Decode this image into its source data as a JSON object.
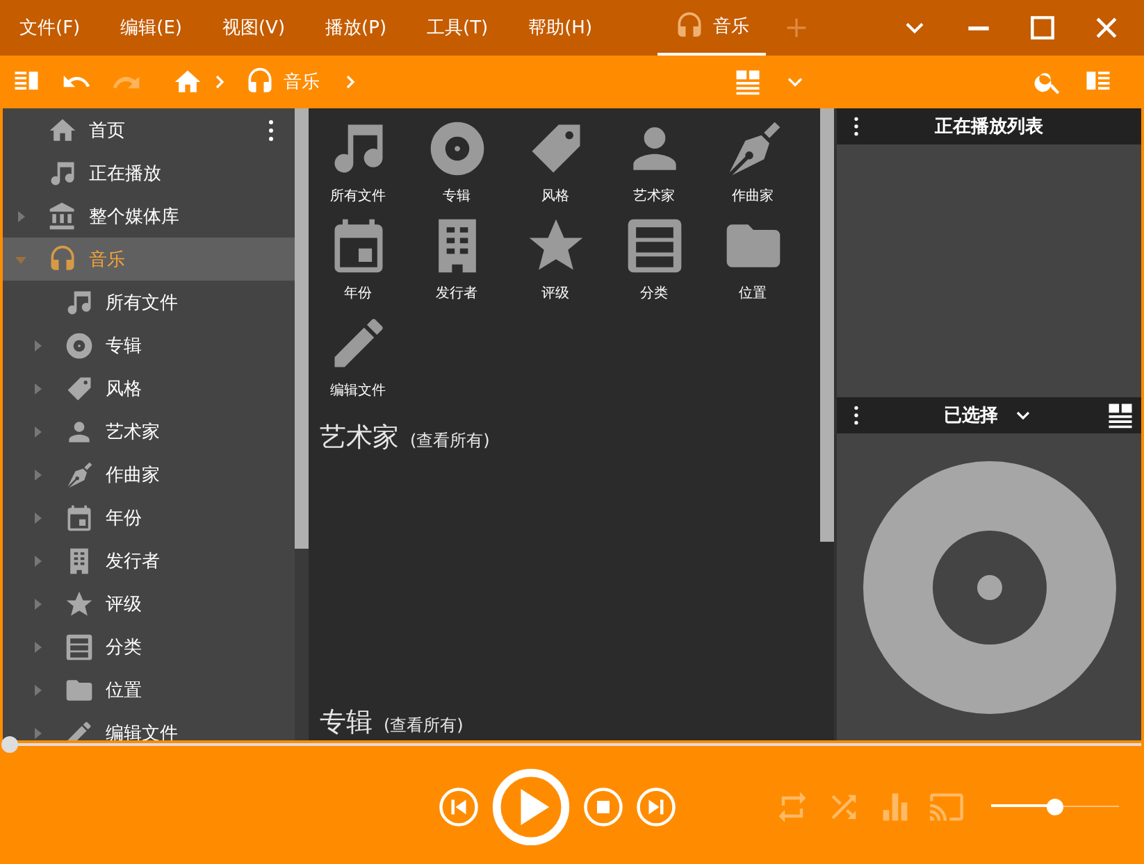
{
  "menu": [
    "文件(F)",
    "编辑(E)",
    "视图(V)",
    "播放(P)",
    "工具(T)",
    "帮助(H)"
  ],
  "tabs": [
    {
      "label": "音乐",
      "selected": true
    }
  ],
  "toolbar": {
    "redo": {
      "disabled": true
    },
    "breadcrumb": [
      "音乐"
    ]
  },
  "sidebar": {
    "items": [
      {
        "label": "首页",
        "kind": "leaf",
        "selected": false
      },
      {
        "label": "正在播放",
        "kind": "leaf",
        "selected": false
      },
      {
        "label": "整个媒体库",
        "kind": "folder",
        "expanded": false,
        "selected": false
      },
      {
        "label": "音乐",
        "kind": "folder",
        "expanded": true,
        "selected": true,
        "children": [
          {
            "label": "所有文件",
            "kind": "leaf",
            "selected": false
          },
          {
            "label": "专辑",
            "kind": "folder",
            "expanded": false,
            "selected": false
          },
          {
            "label": "风格",
            "kind": "folder",
            "expanded": false,
            "selected": false
          },
          {
            "label": "艺术家",
            "kind": "folder",
            "expanded": false,
            "selected": false
          },
          {
            "label": "作曲家",
            "kind": "folder",
            "expanded": false,
            "selected": false
          },
          {
            "label": "年份",
            "kind": "folder",
            "expanded": false,
            "selected": false
          },
          {
            "label": "发行者",
            "kind": "folder",
            "expanded": false,
            "selected": false
          },
          {
            "label": "评级",
            "kind": "folder",
            "expanded": false,
            "selected": false
          },
          {
            "label": "分类",
            "kind": "folder",
            "expanded": false,
            "selected": false
          },
          {
            "label": "位置",
            "kind": "folder",
            "expanded": false,
            "selected": false
          },
          {
            "label": "编辑文件",
            "kind": "folder",
            "expanded": false,
            "selected": false
          }
        ]
      }
    ]
  },
  "categories": [
    "所有文件",
    "专辑",
    "风格",
    "艺术家",
    "作曲家",
    "年份",
    "发行者",
    "评级",
    "分类",
    "位置",
    "编辑文件"
  ],
  "sections": [
    {
      "title": "艺术家",
      "link": "(查看所有)"
    },
    {
      "title": "专辑",
      "link": "(查看所有)"
    }
  ],
  "now_playing": {
    "title": "正在播放列表"
  },
  "selected_panel": {
    "title": "已选择"
  },
  "player": {
    "seek": {
      "level": 0
    },
    "repeat": false,
    "shuffle": false,
    "volume": {
      "level": 0.5
    }
  }
}
